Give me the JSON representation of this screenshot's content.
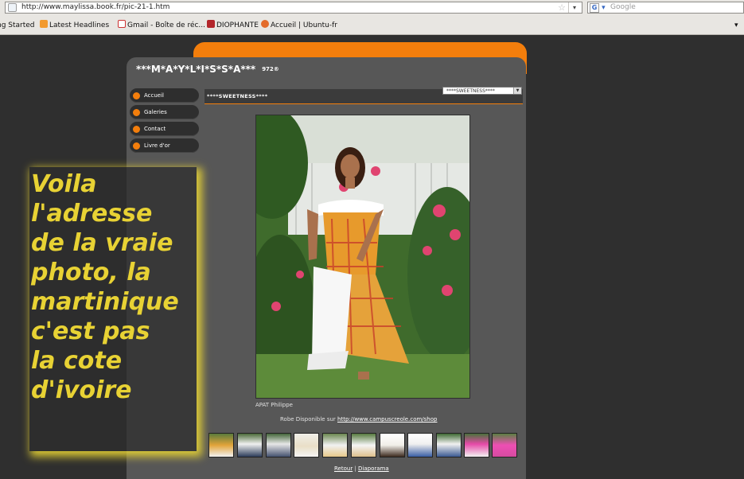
{
  "browser": {
    "url": "http://www.maylissa.book.fr/pic-21-1.htm",
    "search_placeholder": "Google",
    "search_engine_icon": "G",
    "bookmarks": [
      {
        "label": "ng Started",
        "icon": "none"
      },
      {
        "label": "Latest Headlines",
        "icon": "rss-icon"
      },
      {
        "label": "Gmail - Boîte de réc...",
        "icon": "gmail-icon"
      },
      {
        "label": "DIOPHANTE",
        "icon": "diophante-icon"
      },
      {
        "label": "Accueil | Ubuntu-fr",
        "icon": "ubuntu-icon"
      }
    ],
    "bookmarks_dropdown": "▾"
  },
  "site": {
    "title": "***M*A*Y*L*I*S*S*A***",
    "subtitle": "972®",
    "nav": [
      "Accueil",
      "Galeries",
      "Contact",
      "Livre d'or"
    ]
  },
  "gallery": {
    "title": "****SWEETNESS****",
    "selected": "****SWEETNESS****",
    "caption": "APAT Philippe",
    "availability_prefix": "Robe Disponible sur ",
    "availability_link": "http://www.campuscreole.com/shop",
    "thumbnail_count": 11,
    "links": {
      "back": "Retour",
      "separator": "|",
      "slideshow": "Diaporama"
    }
  },
  "annotation": {
    "text": "Voila\nl'adresse\nde la vraie\nphoto, la\nmartinique\nc'est pas\nla cote\nd'ivoire"
  },
  "colors": {
    "accent": "#f37e0c",
    "panel": "#575757",
    "background": "#2f2f2f",
    "annotation_text": "#e8d234"
  }
}
